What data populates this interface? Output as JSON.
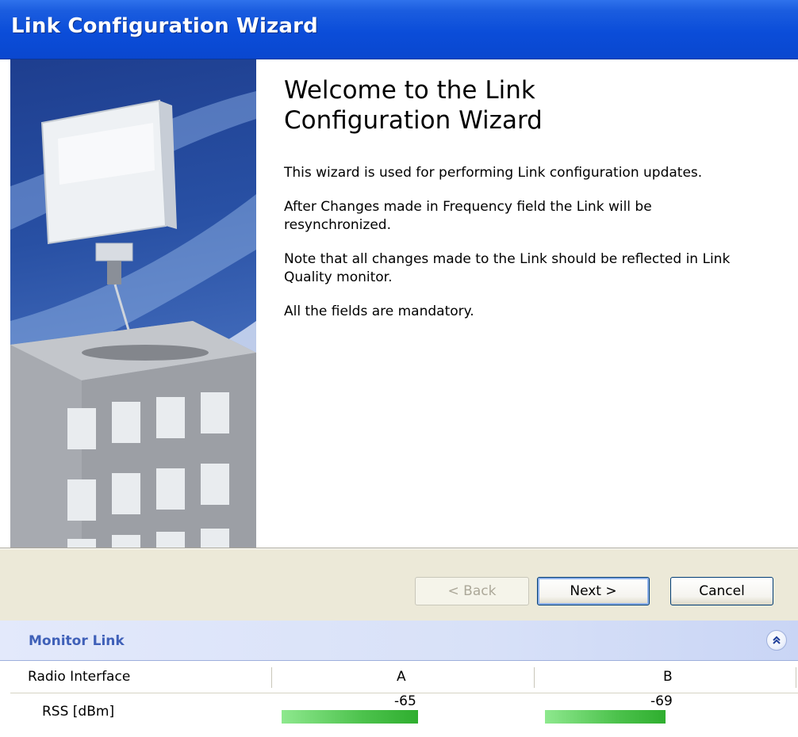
{
  "window": {
    "title": "Link Configuration Wizard"
  },
  "wizard": {
    "heading": "Welcome to the Link Configuration Wizard",
    "paragraphs": [
      "This wizard is used for performing Link configuration updates.",
      "After Changes made in Frequency field the Link will be resynchronized.",
      "Note that all changes made to the Link should be reflected in Link Quality monitor.",
      "All the fields are mandatory."
    ]
  },
  "buttons": {
    "back": "< Back",
    "next": "Next >",
    "cancel": "Cancel"
  },
  "monitor": {
    "title": "Monitor Link",
    "columns": [
      "Radio Interface",
      "A",
      "B"
    ],
    "rows": [
      {
        "label": "RSS [dBm]",
        "a": "-65",
        "b": "-69",
        "a_level_fraction": 0.52,
        "b_level_fraction": 0.46
      }
    ]
  },
  "colors": {
    "title_bar": "#0b4dd9",
    "button_face": "#ece9d8",
    "monitor_header": "#d8e1f8",
    "monitor_title": "#3f60b8",
    "bar_green": "#4cc24c"
  }
}
